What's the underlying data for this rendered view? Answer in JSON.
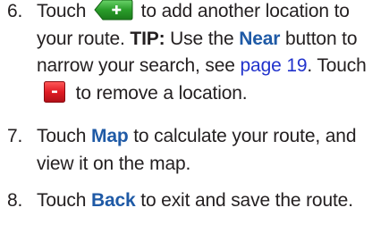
{
  "steps": [
    {
      "num": "6.",
      "t1": "Touch ",
      "t2": " to add another location to your route. ",
      "tip": "TIP:",
      "t3": " Use the ",
      "near": "Near",
      "t4": " button to narrow your search, see ",
      "link": "page 19",
      "t5": ". Touch ",
      "t6": " to remove a location."
    },
    {
      "num": "7.",
      "t1": "Touch ",
      "kw": "Map",
      "t2": " to calculate your route, and view it on the map."
    },
    {
      "num": "8.",
      "t1": "Touch ",
      "kw": "Back",
      "t2": " to exit and save the route."
    }
  ],
  "icons": {
    "add": "add-location-icon",
    "remove": "remove-location-icon"
  },
  "colors": {
    "text": "#231f20",
    "keyword": "#1f5aa6",
    "link": "#2233cc",
    "add_green": "#2a9d2a",
    "remove_red": "#e01b24"
  }
}
